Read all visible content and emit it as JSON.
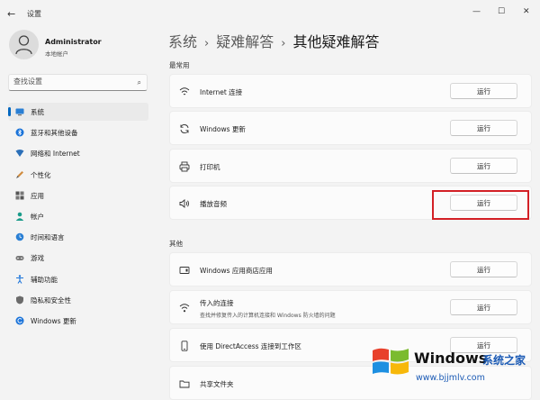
{
  "window": {
    "back_glyph": "←",
    "title": "设置",
    "controls": [
      "—",
      "☐",
      "✕"
    ]
  },
  "profile": {
    "name": "Administrator",
    "account_type": "本地帐户"
  },
  "search": {
    "placeholder": "查找设置",
    "icon": "search-icon"
  },
  "nav": {
    "items": [
      {
        "label": "系统",
        "icon": "system-icon",
        "active": true
      },
      {
        "label": "蓝牙和其他设备",
        "icon": "bluetooth-icon"
      },
      {
        "label": "网络和 Internet",
        "icon": "network-icon"
      },
      {
        "label": "个性化",
        "icon": "personalization-icon"
      },
      {
        "label": "应用",
        "icon": "apps-icon"
      },
      {
        "label": "帐户",
        "icon": "account-icon"
      },
      {
        "label": "时间和语言",
        "icon": "time-language-icon"
      },
      {
        "label": "游戏",
        "icon": "gaming-icon"
      },
      {
        "label": "辅助功能",
        "icon": "accessibility-icon"
      },
      {
        "label": "隐私和安全性",
        "icon": "privacy-icon"
      },
      {
        "label": "Windows 更新",
        "icon": "windows-update-icon"
      }
    ]
  },
  "breadcrumb": {
    "items": [
      "系统",
      "疑难解答",
      "其他疑难解答"
    ],
    "separator": "›"
  },
  "sections": {
    "most_common": {
      "title": "最常用",
      "items": [
        {
          "title": "Internet 连接",
          "icon": "wifi-icon",
          "button": "运行"
        },
        {
          "title": "Windows 更新",
          "icon": "refresh-icon",
          "button": "运行"
        },
        {
          "title": "打印机",
          "icon": "printer-icon",
          "button": "运行"
        },
        {
          "title": "播放音频",
          "icon": "speaker-icon",
          "button": "运行"
        }
      ]
    },
    "other": {
      "title": "其他",
      "items": [
        {
          "title": "Windows 应用商店应用",
          "icon": "store-app-icon",
          "button": "运行"
        },
        {
          "title": "传入的连接",
          "subtitle": "查找并修复传入的计算机连接和 Windows 防火墙的问题",
          "icon": "incoming-connection-icon",
          "button": "运行"
        },
        {
          "title": "使用 DirectAccess 连接到工作区",
          "icon": "phone-icon",
          "button": "运行"
        },
        {
          "title": "共享文件夹",
          "icon": "folder-icon"
        }
      ]
    }
  },
  "watermark": {
    "brand": "Windows",
    "suffix": "系统之家",
    "url": "www.bjjmlv.com"
  },
  "colors": {
    "accent": "#0067c0",
    "highlight_box": "#d32026"
  }
}
